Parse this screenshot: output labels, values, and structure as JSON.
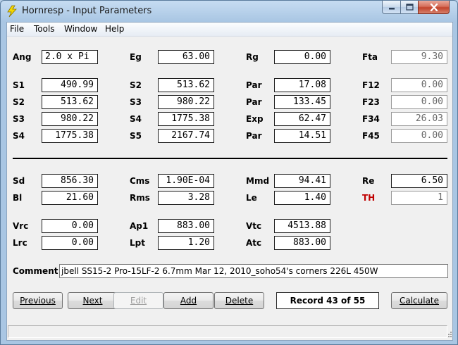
{
  "window": {
    "title": "Hornresp - Input Parameters",
    "app_icon": "lightning-bolt-icon",
    "controls": [
      "minimize-icon",
      "maximize-icon",
      "close-icon"
    ],
    "colors": {
      "close_button": "#c2432b",
      "accent_label": "#c00000"
    }
  },
  "menu": {
    "file": "File",
    "tools": "Tools",
    "window": "Window",
    "help": "Help"
  },
  "horn": {
    "ang": {
      "label": "Ang",
      "value": "2.0 x Pi"
    },
    "eg": {
      "label": "Eg",
      "value": "63.00"
    },
    "rg": {
      "label": "Rg",
      "value": "0.00"
    },
    "fta": {
      "label": "Fta",
      "value": "9.30"
    },
    "col1": [
      {
        "label": "S1",
        "value": "490.99"
      },
      {
        "label": "S2",
        "value": "513.62"
      },
      {
        "label": "S3",
        "value": "980.22"
      },
      {
        "label": "S4",
        "value": "1775.38"
      }
    ],
    "col2": [
      {
        "label": "S2",
        "value": "513.62"
      },
      {
        "label": "S3",
        "value": "980.22"
      },
      {
        "label": "S4",
        "value": "1775.38"
      },
      {
        "label": "S5",
        "value": "2167.74"
      }
    ],
    "col3": [
      {
        "label": "Par",
        "value": "17.08"
      },
      {
        "label": "Par",
        "value": "133.45"
      },
      {
        "label": "Exp",
        "value": "62.47"
      },
      {
        "label": "Par",
        "value": "14.51"
      }
    ],
    "col4": [
      {
        "label": "F12",
        "value": "0.00"
      },
      {
        "label": "F23",
        "value": "0.00"
      },
      {
        "label": "F34",
        "value": "26.03"
      },
      {
        "label": "F45",
        "value": "0.00"
      }
    ]
  },
  "driver": {
    "sd": {
      "label": "Sd",
      "value": "856.30"
    },
    "cms": {
      "label": "Cms",
      "value": "1.90E-04"
    },
    "mmd": {
      "label": "Mmd",
      "value": "94.41"
    },
    "re": {
      "label": "Re",
      "value": "6.50"
    },
    "bl": {
      "label": "Bl",
      "value": "21.60"
    },
    "rms": {
      "label": "Rms",
      "value": "3.28"
    },
    "le": {
      "label": "Le",
      "value": "1.40"
    },
    "th": {
      "label": "TH",
      "value": "1"
    }
  },
  "chambers": {
    "vrc": {
      "label": "Vrc",
      "value": "0.00"
    },
    "ap1": {
      "label": "Ap1",
      "value": "883.00"
    },
    "vtc": {
      "label": "Vtc",
      "value": "4513.88"
    },
    "lrc": {
      "label": "Lrc",
      "value": "0.00"
    },
    "lpt": {
      "label": "Lpt",
      "value": "1.20"
    },
    "atc": {
      "label": "Atc",
      "value": "883.00"
    }
  },
  "comment": {
    "label": "Comment",
    "value": "jbell SS15-2 Pro-15LF-2 6.7mm Mar 12, 2010_soho54's corners 226L 450W"
  },
  "buttons": {
    "previous": "Previous",
    "next": "Next",
    "edit": "Edit",
    "add": "Add",
    "delete": "Delete",
    "calculate": "Calculate"
  },
  "record": "Record 43 of 55"
}
